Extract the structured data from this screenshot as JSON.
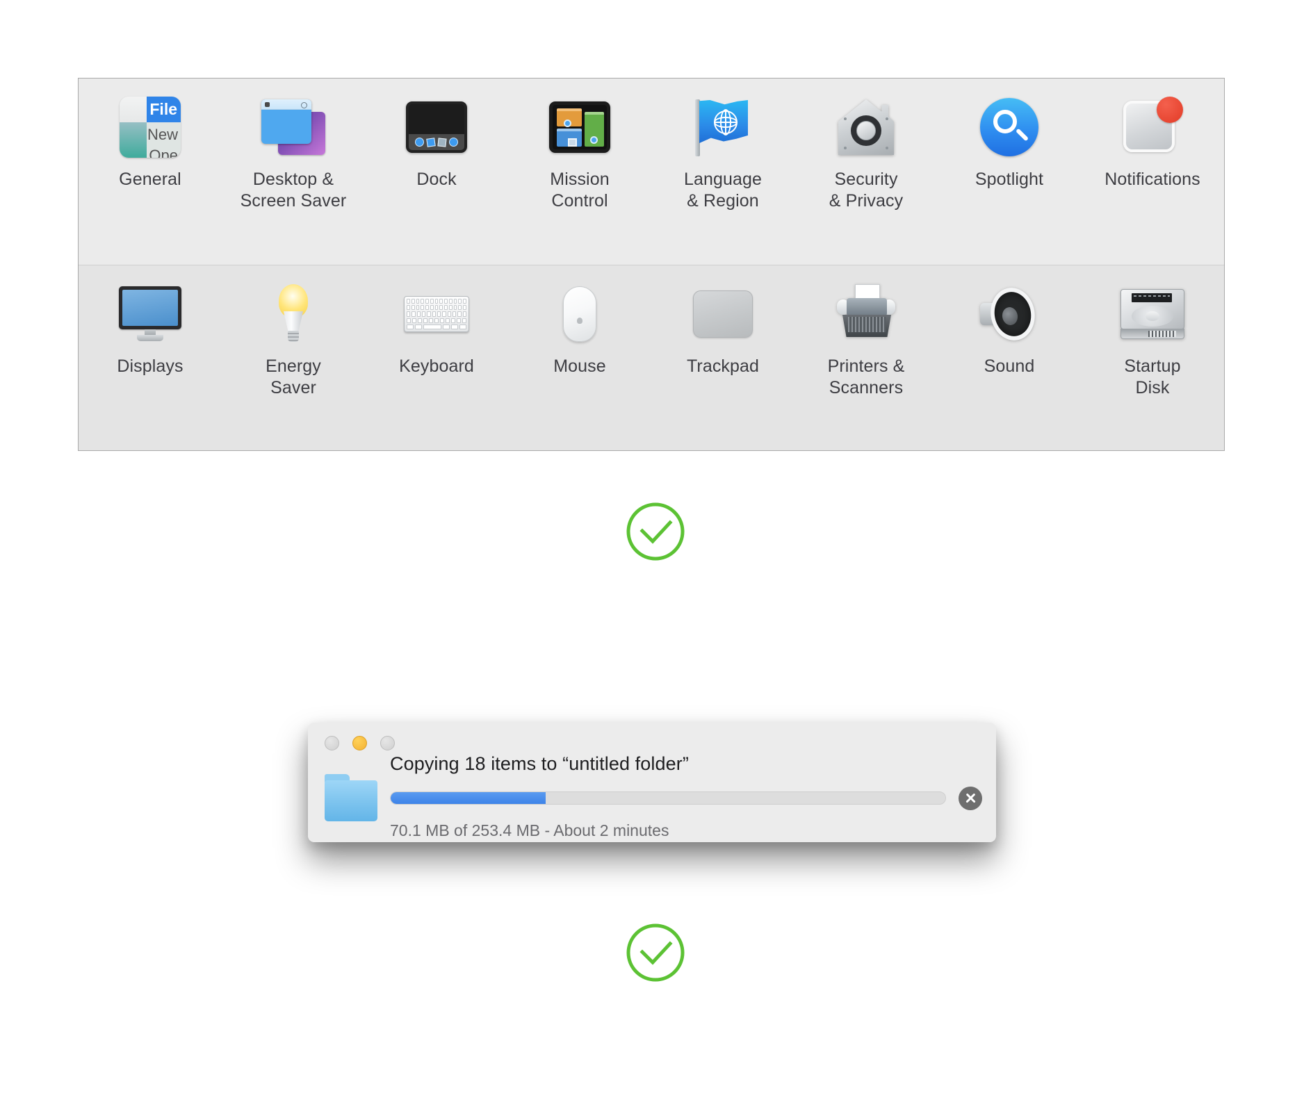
{
  "preferences_panel": {
    "rows": [
      {
        "items": [
          {
            "label": "General",
            "icon": "general-icon",
            "glyph_texts": {
              "file": "File",
              "new": "New",
              "open": "Ope"
            }
          },
          {
            "label": "Desktop &\nScreen Saver",
            "icon": "desktop-screensaver-icon"
          },
          {
            "label": "Dock",
            "icon": "dock-icon"
          },
          {
            "label": "Mission\nControl",
            "icon": "mission-control-icon"
          },
          {
            "label": "Language\n& Region",
            "icon": "language-region-icon"
          },
          {
            "label": "Security\n& Privacy",
            "icon": "security-privacy-icon"
          },
          {
            "label": "Spotlight",
            "icon": "spotlight-icon"
          },
          {
            "label": "Notifications",
            "icon": "notifications-icon"
          }
        ]
      },
      {
        "items": [
          {
            "label": "Displays",
            "icon": "displays-icon"
          },
          {
            "label": "Energy\nSaver",
            "icon": "energy-saver-icon"
          },
          {
            "label": "Keyboard",
            "icon": "keyboard-icon"
          },
          {
            "label": "Mouse",
            "icon": "mouse-icon"
          },
          {
            "label": "Trackpad",
            "icon": "trackpad-icon"
          },
          {
            "label": "Printers &\nScanners",
            "icon": "printers-scanners-icon"
          },
          {
            "label": "Sound",
            "icon": "sound-icon"
          },
          {
            "label": "Startup\nDisk",
            "icon": "startup-disk-icon"
          }
        ]
      }
    ]
  },
  "copy_dialog": {
    "title": "Copying 18 items to “untitled folder”",
    "status": "70.1 MB of 253.4 MB - About 2 minutes",
    "progress_percent": 28,
    "item_count": 18,
    "destination": "untitled folder",
    "transferred": "70.1 MB",
    "total": "253.4 MB",
    "time_remaining": "About 2 minutes",
    "window_controls": [
      "close",
      "minimize",
      "zoom"
    ],
    "cancel_label": "×"
  },
  "check_marks": [
    {
      "name": "check-mark-top"
    },
    {
      "name": "check-mark-bottom"
    }
  ],
  "colors": {
    "accent_blue": "#3d83e8",
    "check_green": "#5cc234",
    "panel_bg_row1": "#ebebeb",
    "panel_bg_row2": "#e4e4e4",
    "notification_badge_red": "#e23b26",
    "traffic_amber": "#f3b233"
  }
}
